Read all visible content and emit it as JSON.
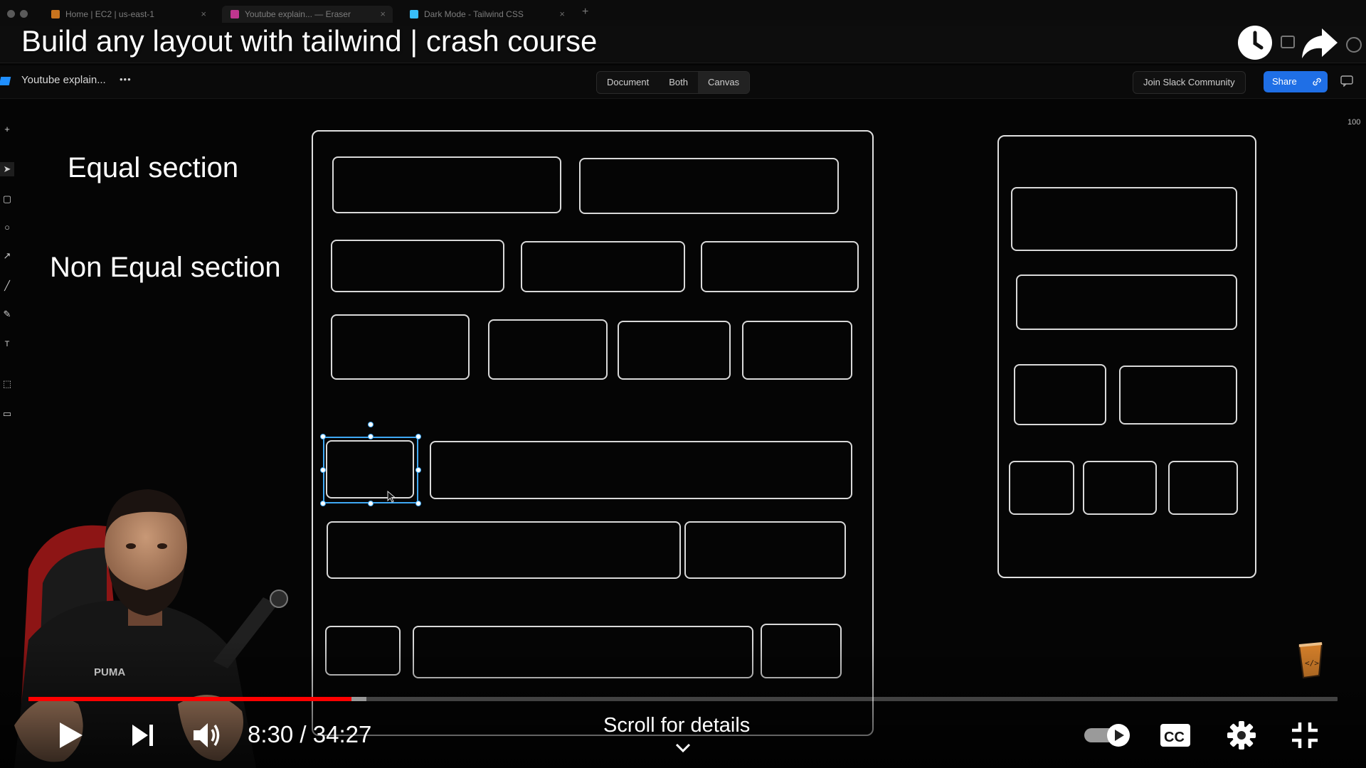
{
  "browser": {
    "tabs": [
      {
        "label": "Home | EC2 | us-east-1",
        "favicon_color": "#c8741e"
      },
      {
        "label": "Youtube explain... — Eraser",
        "favicon_color": "#c0368f"
      },
      {
        "label": "Dark Mode - Tailwind CSS",
        "favicon_color": "#38bdf8"
      }
    ],
    "new_tab_label": "+"
  },
  "video": {
    "title": "Build any layout with tailwind | crash course",
    "progress_fraction": 0.2465,
    "buffered_fraction": 0.258,
    "current_time": "8:30",
    "duration": "34:27",
    "time_separator": " / ",
    "scroll_hint": "Scroll for details",
    "accent_color": "#ff0000"
  },
  "app": {
    "doc_name": "Youtube explain...",
    "more_label": "•••",
    "view_modes": [
      "Document",
      "Both",
      "Canvas"
    ],
    "active_view": "Canvas",
    "join_slack_label": "Join Slack Community",
    "share_label": "Share",
    "zoom_label": "100"
  },
  "canvas": {
    "labels": {
      "equal": "Equal section",
      "non_equal": "Non Equal section"
    }
  },
  "icons": {
    "watch_later": "clock-icon",
    "share": "share-arrow-icon",
    "play": "play-icon",
    "next": "skip-next-icon",
    "volume": "volume-icon",
    "autoplay": "autoplay-toggle-icon",
    "captions": "cc-icon",
    "settings": "gear-icon",
    "exit_fullscreen": "exit-fullscreen-icon"
  }
}
